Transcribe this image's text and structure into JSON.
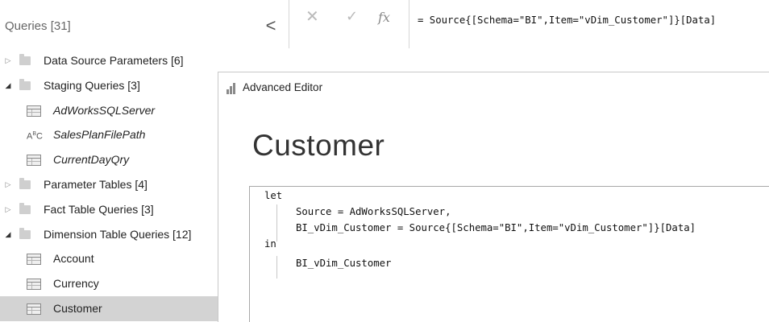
{
  "queries": {
    "title": "Queries [31]",
    "collapse_glyph": "<",
    "items": [
      {
        "label": "Data Source Parameters [6]",
        "kind": "group",
        "expanded": false,
        "caret": "▷"
      },
      {
        "label": "Staging Queries [3]",
        "kind": "group",
        "expanded": true,
        "caret": "◢"
      },
      {
        "label": "AdWorksSQLServer",
        "kind": "query",
        "icon": "table-icon"
      },
      {
        "label": "SalesPlanFilePath",
        "kind": "query",
        "icon": "text-type-icon",
        "icon_text": "A",
        "icon_sup": "B",
        "icon_sub": "C"
      },
      {
        "label": "CurrentDayQry",
        "kind": "query",
        "icon": "table-icon"
      },
      {
        "label": "Parameter Tables [4]",
        "kind": "group",
        "expanded": false,
        "caret": "▷"
      },
      {
        "label": "Fact Table Queries [3]",
        "kind": "group",
        "expanded": false,
        "caret": "▷"
      },
      {
        "label": "Dimension Table Queries [12]",
        "kind": "group",
        "expanded": true,
        "caret": "◢"
      },
      {
        "label": "Account",
        "kind": "query",
        "icon": "table-icon"
      },
      {
        "label": "Currency",
        "kind": "query",
        "icon": "table-icon"
      },
      {
        "label": "Customer",
        "kind": "query",
        "icon": "table-icon",
        "selected": true
      }
    ]
  },
  "formula_bar": {
    "cancel_glyph": "✕",
    "commit_glyph": "✓",
    "fx_glyph": "fx",
    "formula": "= Source{[Schema=\"BI\",Item=\"vDim_Customer\"]}[Data]"
  },
  "editor": {
    "window_title": "Advanced Editor",
    "query_name": "Customer",
    "code_lines": [
      "let",
      "Source = AdWorksSQLServer,",
      "BI_vDim_Customer = Source{[Schema=\"BI\",Item=\"vDim_Customer\"]}[Data]",
      "in",
      "BI_vDim_Customer"
    ]
  },
  "colors": {
    "selected_row": "#d3d3d3",
    "folder": "#cfcfcf"
  }
}
